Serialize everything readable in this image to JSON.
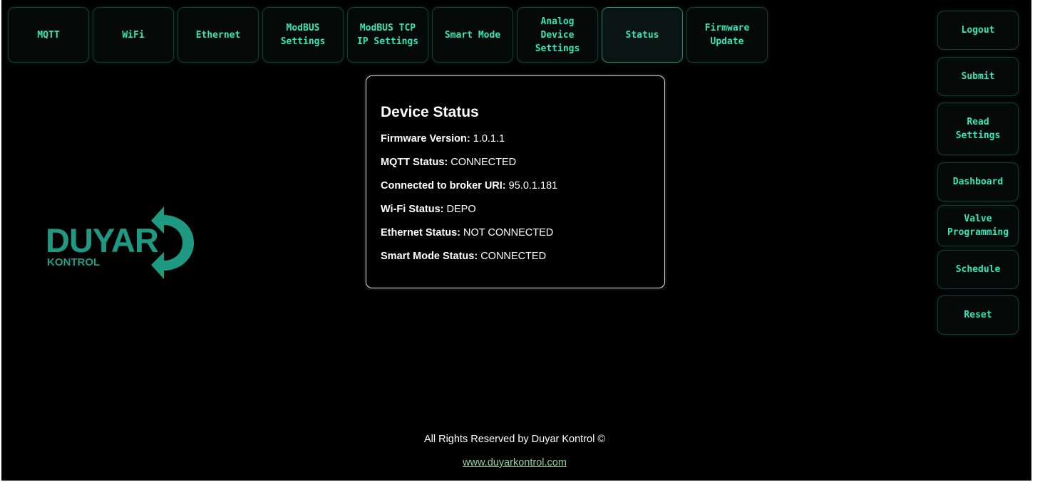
{
  "nav_tabs": [
    {
      "label": "MQTT"
    },
    {
      "label": "WiFi"
    },
    {
      "label": "Ethernet"
    },
    {
      "label": "ModBUS\nSettings"
    },
    {
      "label": "ModBUS TCP\nIP Settings"
    },
    {
      "label": "Smart Mode"
    },
    {
      "label": "Analog\nDevice\nSettings"
    },
    {
      "label": "Status"
    },
    {
      "label": "Firmware\nUpdate"
    }
  ],
  "active_tab": "Status",
  "side_buttons": [
    {
      "label": "Logout"
    },
    {
      "label": "Submit"
    },
    {
      "label": "Read\nSettings"
    },
    {
      "label": "Dashboard"
    },
    {
      "label": "Valve\nProgramming"
    },
    {
      "label": "Schedule"
    },
    {
      "label": "Reset"
    }
  ],
  "status": {
    "title": "Device Status",
    "rows": [
      {
        "label": "Firmware Version:",
        "value": "1.0.1.1"
      },
      {
        "label": "MQTT Status:",
        "value": "CONNECTED"
      },
      {
        "label": "Connected to broker URI:",
        "value": "95.0.1.181"
      },
      {
        "label": "Wi-Fi Status:",
        "value": "DEPO"
      },
      {
        "label": "Ethernet Status:",
        "value": "NOT CONNECTED"
      },
      {
        "label": "Smart Mode Status:",
        "value": "CONNECTED"
      }
    ]
  },
  "logo": {
    "name": "DUYAR",
    "sub": "KONTROL",
    "icon": "circular-arrow-icon"
  },
  "footer": {
    "rights": "All Rights Reserved by Duyar Kontrol ©",
    "link": "www.duyarkontrol.com"
  },
  "colors": {
    "background": "#000000",
    "accent": "#33e6b8",
    "brand": "#1f9a82",
    "link": "#8fd19a"
  }
}
